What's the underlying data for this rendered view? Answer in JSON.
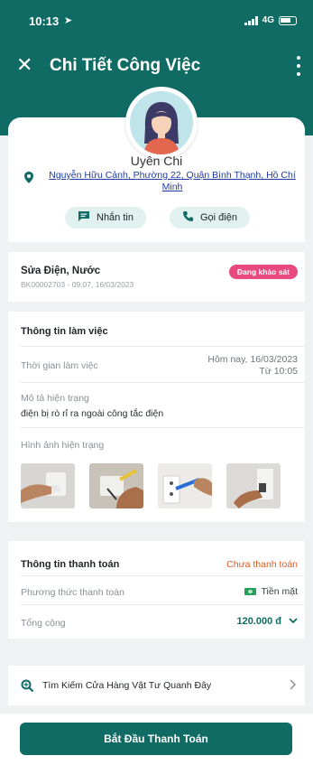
{
  "status_bar": {
    "time": "10:13",
    "network": "4G"
  },
  "header": {
    "title": "Chi Tiết Công Việc"
  },
  "profile": {
    "name": "Uyên Chi",
    "address": "Nguyễn Hữu Cảnh, Phường 22, Quận Bình Thạnh, Hồ Chí Minh",
    "message_label": "Nhắn tin",
    "call_label": "Gọi điện"
  },
  "job": {
    "title": "Sửa Điện, Nước",
    "code": "BK00002703 - 09:07, 16/03/2023",
    "status": "Đang khảo sát"
  },
  "work_info": {
    "section_title": "Thông tin làm việc",
    "time_label": "Thời gian làm việc",
    "time_value_line1": "Hôm nay, 16/03/2023",
    "time_value_line2": "Từ 10:05",
    "condition_label": "Mô tả hiện trạng",
    "condition_value": "điện bị rò rỉ ra ngoài công tắc điện",
    "images_label": "Hình ảnh hiện trạng"
  },
  "payment": {
    "section_title": "Thông tin thanh toán",
    "status": "Chưa thanh toán",
    "method_label": "Phương thức thanh toán",
    "method_value": "Tiền mặt",
    "total_label": "Tổng cộng",
    "total_value": "120.000 đ"
  },
  "search": {
    "label": "Tìm Kiếm Cửa Hàng Vật Tư Quanh Đây"
  },
  "footer": {
    "button_label": "Bắt Đầu Thanh Toán"
  },
  "colors": {
    "primary": "#0f6b63",
    "badge": "#e84a7f",
    "unpaid": "#e8581a",
    "link": "#1e3ca8"
  }
}
